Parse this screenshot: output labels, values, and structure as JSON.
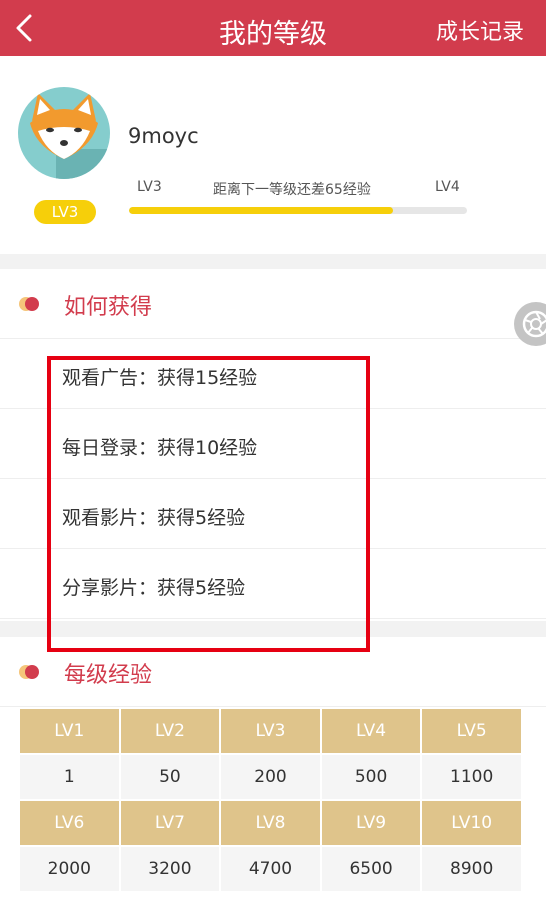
{
  "header": {
    "title": "我的等级",
    "history_label": "成长记录"
  },
  "profile": {
    "username": "9moyc",
    "badge": "LV3",
    "current_level": "LV3",
    "next_level": "LV4",
    "progress_hint": "距离下一等级还差65经验",
    "progress": 0.78
  },
  "how_to_earn": {
    "title": "如何获得",
    "items": [
      "观看广告：获得15经验",
      "每日登录：获得10经验",
      "观看影片：获得5经验",
      "分享影片：获得5经验"
    ]
  },
  "exp_per_level": {
    "title": "每级经验",
    "rows": [
      [
        "LV1",
        "LV2",
        "LV3",
        "LV4",
        "LV5"
      ],
      [
        "1",
        "50",
        "200",
        "500",
        "1100"
      ],
      [
        "LV6",
        "LV7",
        "LV8",
        "LV9",
        "LV10"
      ],
      [
        "2000",
        "3200",
        "4700",
        "6500",
        "8900"
      ]
    ]
  },
  "colors": {
    "brand": "#d23c4d",
    "progress": "#f6cf0a",
    "level_cell": "#dfc48b",
    "highlight": "#e60012"
  }
}
